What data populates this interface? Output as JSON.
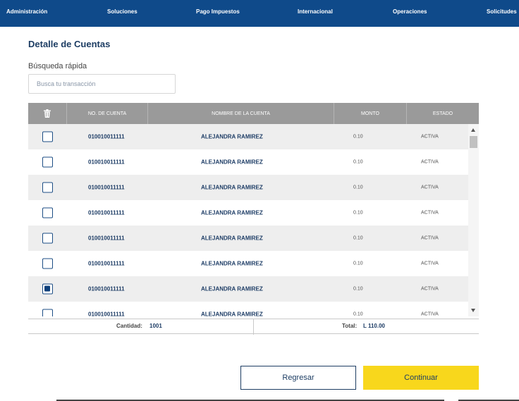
{
  "nav": {
    "items": [
      "Administración",
      "Soluciones",
      "Pago Impuestos",
      "Internacional",
      "Operaciones",
      "Solicitudes"
    ],
    "color": "#0f4a8a"
  },
  "page": {
    "title": "Detalle de Cuentas",
    "search_label": "Búsqueda rápida",
    "search_placeholder": "Busca tu transacción"
  },
  "table": {
    "headers": {
      "delete_icon": "trash-icon",
      "account_number": "NO. DE CUENTA",
      "account_name": "NOMBRE DE LA CUENTA",
      "amount": "MONTO",
      "status": "ESTADO"
    },
    "rows": [
      {
        "checked": false,
        "account_number": "010010011111",
        "account_name": "ALEJANDRA RAMIREZ",
        "amount": "0.10",
        "status": "ACTIVA"
      },
      {
        "checked": false,
        "account_number": "010010011111",
        "account_name": "ALEJANDRA RAMIREZ",
        "amount": "0.10",
        "status": "ACTIVA"
      },
      {
        "checked": false,
        "account_number": "010010011111",
        "account_name": "ALEJANDRA RAMIREZ",
        "amount": "0.10",
        "status": "ACTIVA"
      },
      {
        "checked": false,
        "account_number": "010010011111",
        "account_name": "ALEJANDRA RAMIREZ",
        "amount": "0.10",
        "status": "ACTIVA"
      },
      {
        "checked": false,
        "account_number": "010010011111",
        "account_name": "ALEJANDRA RAMIREZ",
        "amount": "0.10",
        "status": "ACTIVA"
      },
      {
        "checked": false,
        "account_number": "010010011111",
        "account_name": "ALEJANDRA RAMIREZ",
        "amount": "0.10",
        "status": "ACTIVA"
      },
      {
        "checked": true,
        "account_number": "010010011111",
        "account_name": "ALEJANDRA RAMIREZ",
        "amount": "0.10",
        "status": "ACTIVA"
      },
      {
        "checked": false,
        "account_number": "010010011111",
        "account_name": "ALEJANDRA RAMIREZ",
        "amount": "0.10",
        "status": "ACTIVA"
      }
    ]
  },
  "summary": {
    "quantity_label": "Cantidad:",
    "quantity_value": "1001",
    "total_label": "Total:",
    "total_value": "L 110.00"
  },
  "buttons": {
    "back": "Regresar",
    "continue": "Continuar",
    "continue_color": "#f8d71c"
  }
}
